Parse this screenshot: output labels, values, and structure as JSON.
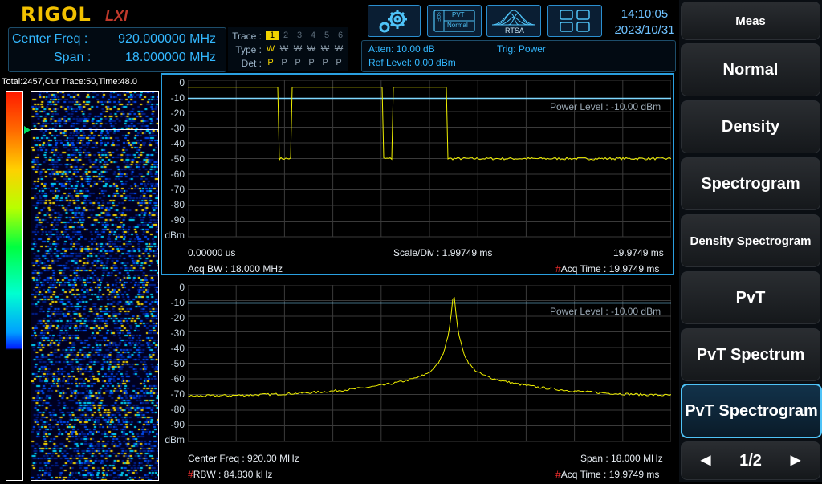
{
  "header": {
    "logo": "RIGOL",
    "lxi": "LXI",
    "center_freq_label": "Center Freq :",
    "center_freq_value": "920.000000 MHz",
    "span_label": "Span :",
    "span_value": "18.000000 MHz",
    "trace_label": "Trace :",
    "type_label": "Type :",
    "det_label": "Det :",
    "trace_numbers": [
      "1",
      "2",
      "3",
      "4",
      "5",
      "6"
    ],
    "trace_types": [
      "W",
      "W",
      "W",
      "W",
      "W",
      "W"
    ],
    "trace_dets": [
      "P",
      "P",
      "P",
      "P",
      "P",
      "P"
    ],
    "atten": "Atten: 10.00 dB",
    "ref_level": "Ref Level: 0.00 dBm",
    "trig": "Trig: Power",
    "pvt_icon_top": "PVT",
    "pvt_icon_bottom": "Normal",
    "pvt_icon_side": "SPE",
    "rtsa_label": "RTSA",
    "time": "14:10:05",
    "date": "2023/10/31"
  },
  "menu": {
    "title": "Meas",
    "items": [
      "Normal",
      "Density",
      "Spectrogram",
      "Density Spectrogram",
      "PvT",
      "PvT Spectrum",
      "PvT Spectrogram"
    ],
    "active_index": 6,
    "page": "1/2"
  },
  "spectrogram": {
    "info": "Total:2457,Cur Trace:50,Time:48.0"
  },
  "pvt_plot": {
    "y_ticks": [
      "0",
      "-10",
      "-20",
      "-30",
      "-40",
      "-50",
      "-60",
      "-70",
      "-80",
      "-90"
    ],
    "y_unit": "dBm",
    "power_level": "Power Level : -10.00 dBm",
    "start_time": "0.00000 us",
    "scale_div": "Scale/Div : 1.99749 ms",
    "stop_time": "19.9749 ms",
    "acq_bw": "Acq BW : 18.000 MHz",
    "acq_time_mark": "#",
    "acq_time": "Acq Time : 19.9749 ms"
  },
  "spectrum_plot": {
    "y_ticks": [
      "0",
      "-10",
      "-20",
      "-30",
      "-40",
      "-50",
      "-60",
      "-70",
      "-80",
      "-90"
    ],
    "y_unit": "dBm",
    "power_level": "Power Level : -10.00 dBm",
    "center_freq": "Center Freq : 920.00 MHz",
    "span": "Span : 18.000 MHz",
    "rbw_mark": "#",
    "rbw": "RBW : 84.830 kHz",
    "acq_time_mark": "#",
    "acq_time": "Acq Time : 19.9749 ms"
  },
  "colors": {
    "trace": "#f0f000",
    "accent": "#33b8ff",
    "logo": "#f2c100"
  }
}
